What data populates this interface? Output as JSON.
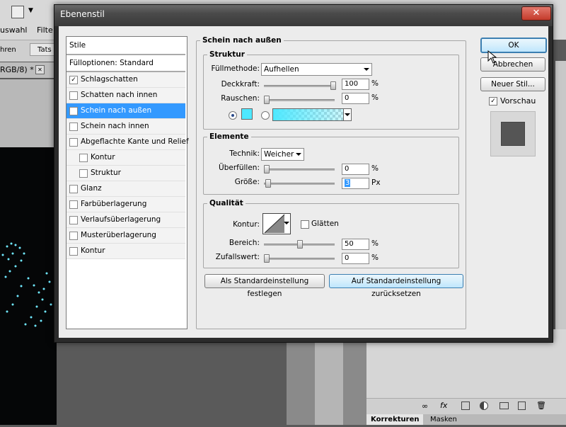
{
  "app": {
    "menu_item": "uswahl",
    "menu_item2": "Filte",
    "opt_left": "hren",
    "opt_field": "Tats",
    "doc_tab": "RGB/8) *",
    "doc_tab_close": "✕"
  },
  "panels": {
    "tab_corrections": "Korrekturen",
    "tab_masks": "Masken"
  },
  "dialog": {
    "title": "Ebenenstil",
    "close": "✕",
    "styles": {
      "header": "Stile",
      "fill_options": "Fülloptionen: Standard",
      "items": [
        {
          "label": "Schlagschatten",
          "checked": true
        },
        {
          "label": "Schatten nach innen",
          "checked": false
        },
        {
          "label": "Schein nach außen",
          "checked": true
        },
        {
          "label": "Schein nach innen",
          "checked": false
        },
        {
          "label": "Abgeflachte Kante und Relief",
          "checked": false
        },
        {
          "label": "Kontur",
          "checked": false
        },
        {
          "label": "Struktur",
          "checked": false
        },
        {
          "label": "Glanz",
          "checked": false
        },
        {
          "label": "Farbüberlagerung",
          "checked": false
        },
        {
          "label": "Verlaufsüberlagerung",
          "checked": false
        },
        {
          "label": "Musterüberlagerung",
          "checked": false
        },
        {
          "label": "Kontur",
          "checked": false
        }
      ]
    },
    "section_title": "Schein nach außen",
    "struktur": {
      "title": "Struktur",
      "blend_label": "Füllmethode:",
      "blend_value": "Aufhellen",
      "opacity_label": "Deckkraft:",
      "opacity_value": "100",
      "noise_label": "Rauschen:",
      "noise_value": "0",
      "unit_pct": "%",
      "glow_color": "#4de8ff"
    },
    "elemente": {
      "title": "Elemente",
      "technique_label": "Technik:",
      "technique_value": "Weicher",
      "spread_label": "Überfüllen:",
      "spread_value": "0",
      "size_label": "Größe:",
      "size_value": "3",
      "unit_pct": "%",
      "unit_px": "Px"
    },
    "qualitaet": {
      "title": "Qualität",
      "contour_label": "Kontur:",
      "smooth_label": "Glätten",
      "range_label": "Bereich:",
      "range_value": "50",
      "jitter_label": "Zufallswert:",
      "jitter_value": "0",
      "unit_pct": "%"
    },
    "buttons": {
      "make_default": "Als Standardeinstellung festlegen",
      "reset_default": "Auf Standardeinstellung zurücksetzen",
      "ok": "OK",
      "cancel": "Abbrechen",
      "new_style": "Neuer Stil...",
      "preview": "Vorschau"
    }
  }
}
